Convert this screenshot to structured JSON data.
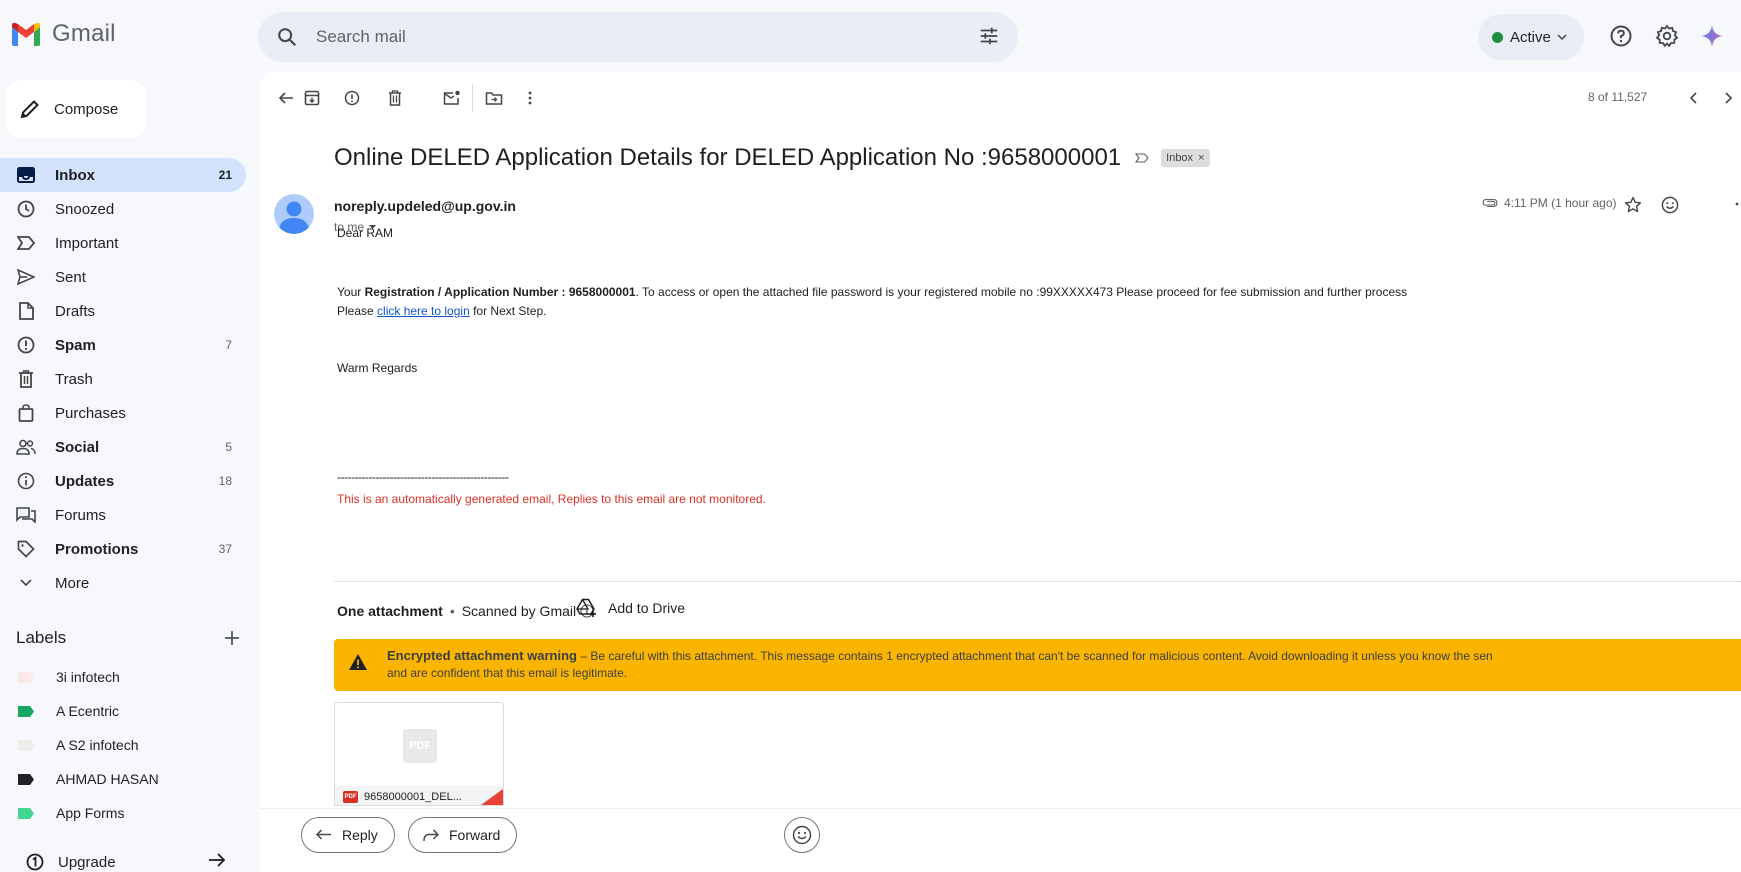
{
  "app": {
    "name": "Gmail"
  },
  "search": {
    "placeholder": "Search mail"
  },
  "status": {
    "label": "Active"
  },
  "compose": {
    "label": "Compose"
  },
  "nav": [
    {
      "label": "Inbox",
      "count": "21",
      "bold": true,
      "active": true
    },
    {
      "label": "Snoozed",
      "count": ""
    },
    {
      "label": "Important",
      "count": ""
    },
    {
      "label": "Sent",
      "count": ""
    },
    {
      "label": "Drafts",
      "count": ""
    },
    {
      "label": "Spam",
      "count": "7",
      "bold": true
    },
    {
      "label": "Trash",
      "count": ""
    },
    {
      "label": "Purchases",
      "count": ""
    },
    {
      "label": "Social",
      "count": "5",
      "bold": true
    },
    {
      "label": "Updates",
      "count": "18",
      "bold": true
    },
    {
      "label": "Forums",
      "count": ""
    },
    {
      "label": "Promotions",
      "count": "37",
      "bold": true
    },
    {
      "label": "More",
      "count": ""
    }
  ],
  "labels": {
    "title": "Labels",
    "items": [
      {
        "name": "3i infotech",
        "color": "#fce8e6"
      },
      {
        "name": "A Ecentric",
        "color": "#16a765"
      },
      {
        "name": "A S2 infotech",
        "color": "#f1f3f4"
      },
      {
        "name": "AHMAD HASAN",
        "color": "#202124"
      },
      {
        "name": "App Forms",
        "color": "#43d692"
      }
    ]
  },
  "upgrade": {
    "label": "Upgrade"
  },
  "pager": {
    "text": "8 of 11,527"
  },
  "email": {
    "subject": "Online DELED Application Details for DELED Application No :9658000001",
    "chip": "Inbox",
    "chip_close": "×",
    "sender": "noreply.updeled@up.gov.in",
    "to": "to me",
    "time": "4:11 PM (1 hour ago)",
    "greeting": "Dear RAM",
    "line1_prefix": "Your ",
    "line1_bold": "Registration / Application Number : 9658000001",
    "line1_rest": ". To access or open the attached file password is your registered mobile no :99XXXXX473 Please proceed for fee submission and further process",
    "line2_prefix": "Please ",
    "line2_link": "click here to login",
    "line2_rest": " for Next Step.",
    "regards": "Warm Regards",
    "divider": "-------------------------------------------------",
    "auto_note": "This is an automatically generated email, Replies to this email are not monitored."
  },
  "attachments": {
    "count_label": "One attachment",
    "separator": "•",
    "scanned": "Scanned by Gmail",
    "add_drive": "Add to Drive",
    "warning_title": "Encrypted attachment warning",
    "warning_text": " – Be careful with this attachment. This message contains 1 encrypted attachment that can't be scanned for malicious content. Avoid downloading it unless you know the sen",
    "warning_text2": "and are confident that this email is legitimate.",
    "file_badge": "PDF",
    "file_name": "9658000001_DEL..."
  },
  "actions": {
    "reply": "Reply",
    "forward": "Forward"
  },
  "colors": {
    "active_nav": "#d3e3fd",
    "warning": "#fbb400",
    "link": "#1155cc",
    "alert_text": "#d93025",
    "online": "#1e8e3e"
  },
  "icons": [
    "gmail-logo",
    "search-icon",
    "tune-icon",
    "help-icon",
    "settings-icon",
    "gemini-icon",
    "pencil-icon",
    "back-arrow-icon",
    "archive-icon",
    "report-spam-icon",
    "delete-icon",
    "mark-unread-icon",
    "move-to-icon",
    "more-vert-icon",
    "chevron-left-icon",
    "chevron-right-icon",
    "importance-marker-icon",
    "attachment-clip-icon",
    "star-icon",
    "emoji-icon",
    "warning-icon",
    "drive-add-icon",
    "reply-icon",
    "forward-icon",
    "plus-icon",
    "upgrade-arrow-icon"
  ]
}
